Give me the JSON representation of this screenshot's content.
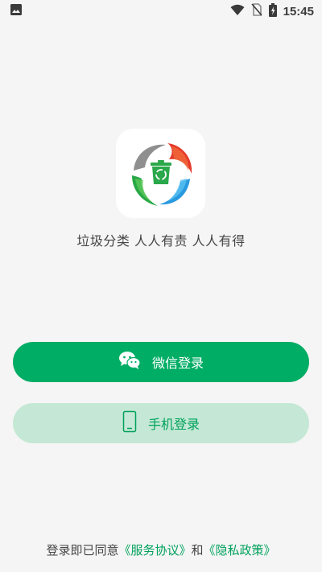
{
  "status_bar": {
    "time": "15:45",
    "icons": [
      "image-icon",
      "wifi-icon",
      "no-sim-icon",
      "battery-charging-icon"
    ]
  },
  "app": {
    "slogan": "垃圾分类 人人有责 人人有得"
  },
  "buttons": {
    "wechat_label": "微信登录",
    "phone_label": "手机登录"
  },
  "agreement": {
    "prefix": "登录即已同意",
    "service_link": "《服务协议》",
    "connector": "和",
    "privacy_link": "《隐私政策》"
  },
  "colors": {
    "primary": "#00ad65",
    "primary_light": "#c4e8d5",
    "link": "#00a15c",
    "background": "#f5f5f5"
  }
}
